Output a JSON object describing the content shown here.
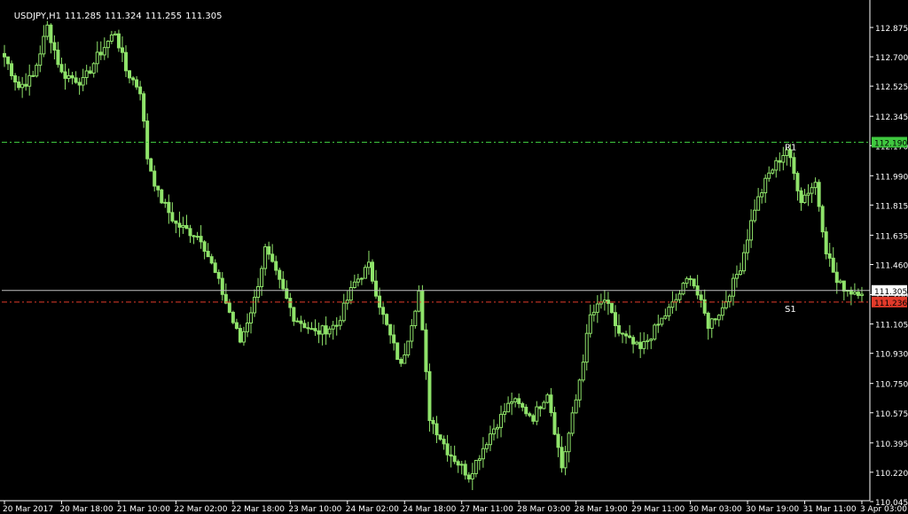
{
  "header": {
    "symbol": "USDJPY,H1",
    "open": "111.285",
    "high": "111.324",
    "low": "111.255",
    "close": "111.305"
  },
  "colors": {
    "background": "#000000",
    "axis": "#ffffff",
    "candle": "#8fe36a",
    "resistance": "#3fc83f",
    "support": "#e23a2a",
    "current_price_line": "#bfbfbf"
  },
  "levels": {
    "resistance": {
      "label": "R1",
      "price": 112.19,
      "price_text": "112.190"
    },
    "support": {
      "label": "S1",
      "price": 111.236,
      "price_text": "111.236"
    },
    "current": {
      "price": 111.305,
      "price_text": "111.305"
    }
  },
  "chart_data": {
    "type": "candlestick",
    "title": "",
    "ylim": [
      110.05,
      112.965
    ],
    "y_ticks": [
      "112.875",
      "112.700",
      "112.525",
      "112.345",
      "112.170",
      "111.990",
      "111.815",
      "111.635",
      "111.460",
      "111.280",
      "111.105",
      "110.930",
      "110.750",
      "110.575",
      "110.395",
      "110.220",
      "110.045"
    ],
    "x_ticks": [
      "20 Mar 2017",
      "20 Mar 18:00",
      "21 Mar 10:00",
      "22 Mar 02:00",
      "22 Mar 18:00",
      "23 Mar 10:00",
      "24 Mar 02:00",
      "24 Mar 18:00",
      "27 Mar 11:00",
      "28 Mar 03:00",
      "28 Mar 19:00",
      "29 Mar 11:00",
      "30 Mar 03:00",
      "30 Mar 19:00",
      "31 Mar 11:00",
      "3 Apr 03:00"
    ],
    "bars_per_tick": 16,
    "close_path": [
      [
        0,
        112.7
      ],
      [
        4,
        112.52
      ],
      [
        8,
        112.58
      ],
      [
        12,
        112.88
      ],
      [
        16,
        112.6
      ],
      [
        22,
        112.55
      ],
      [
        26,
        112.7
      ],
      [
        31,
        112.85
      ],
      [
        34,
        112.62
      ],
      [
        38,
        112.5
      ],
      [
        40,
        112.1
      ],
      [
        43,
        111.88
      ],
      [
        48,
        111.7
      ],
      [
        55,
        111.62
      ],
      [
        60,
        111.35
      ],
      [
        66,
        111.0
      ],
      [
        70,
        111.25
      ],
      [
        73,
        111.55
      ],
      [
        77,
        111.35
      ],
      [
        81,
        111.15
      ],
      [
        87,
        111.05
      ],
      [
        93,
        111.1
      ],
      [
        98,
        111.35
      ],
      [
        102,
        111.45
      ],
      [
        106,
        111.15
      ],
      [
        111,
        110.85
      ],
      [
        116,
        111.3
      ],
      [
        119,
        110.55
      ],
      [
        124,
        110.35
      ],
      [
        130,
        110.2
      ],
      [
        136,
        110.45
      ],
      [
        142,
        110.65
      ],
      [
        148,
        110.55
      ],
      [
        152,
        110.7
      ],
      [
        156,
        110.25
      ],
      [
        160,
        110.65
      ],
      [
        164,
        111.15
      ],
      [
        168,
        111.25
      ],
      [
        172,
        111.05
      ],
      [
        178,
        110.95
      ],
      [
        183,
        111.1
      ],
      [
        188,
        111.25
      ],
      [
        192,
        111.4
      ],
      [
        197,
        111.1
      ],
      [
        201,
        111.2
      ],
      [
        206,
        111.45
      ],
      [
        210,
        111.8
      ],
      [
        214,
        112.0
      ],
      [
        219,
        112.15
      ],
      [
        223,
        111.85
      ],
      [
        227,
        111.95
      ],
      [
        230,
        111.55
      ],
      [
        233,
        111.35
      ],
      [
        237,
        111.3
      ],
      [
        240,
        111.305
      ]
    ]
  }
}
